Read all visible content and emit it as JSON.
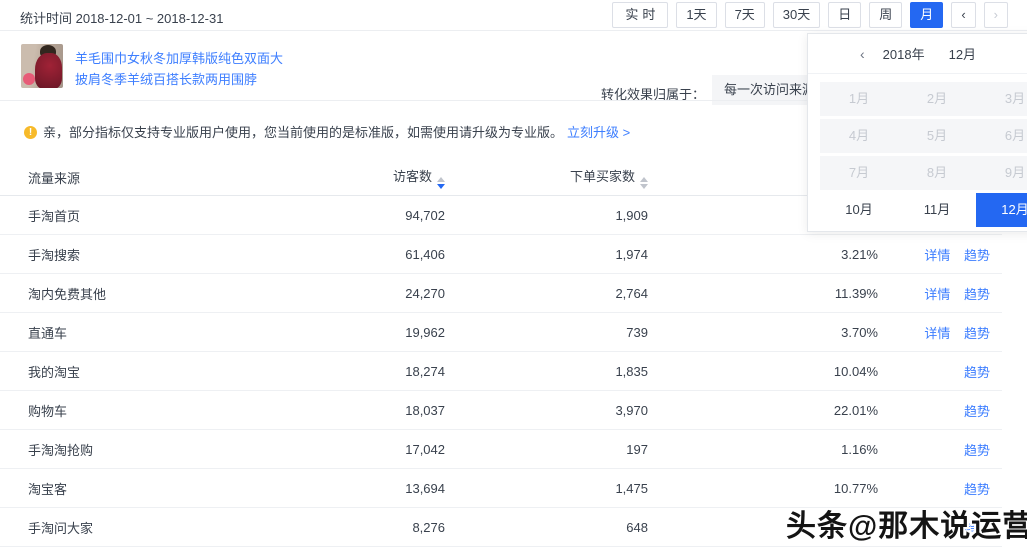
{
  "colors": {
    "accent": "#2468f2",
    "link": "#3d7eff",
    "warning": "#f7ba2a",
    "disabled_text": "#c6cad1"
  },
  "header": {
    "stat_time": "统计时间 2018-12-01 ~ 2018-12-31",
    "range_buttons": [
      {
        "label": "实时",
        "state": "normal"
      },
      {
        "label": "1天",
        "state": "normal"
      },
      {
        "label": "7天",
        "state": "normal"
      },
      {
        "label": "30天",
        "state": "normal"
      },
      {
        "label": "日",
        "state": "normal"
      },
      {
        "label": "周",
        "state": "normal"
      },
      {
        "label": "月",
        "state": "active"
      },
      {
        "label": "‹",
        "state": "normal"
      },
      {
        "label": "›",
        "state": "disabled"
      }
    ]
  },
  "product": {
    "title_line1": "羊毛围巾女秋冬加厚韩版纯色双面大",
    "title_line2": "披肩冬季羊绒百搭长款两用围脖",
    "attribution_label": "转化效果归属于：",
    "attribution_value": "每一次访问来源"
  },
  "notice": {
    "icon_char": "!",
    "text": "亲，部分指标仅支持专业版用户使用，您当前使用的是标准版，如需使用请升级为专业版。",
    "link": "立刻升级 >"
  },
  "date_picker": {
    "prev": "‹",
    "year": "2018年",
    "month": "12月",
    "months": [
      {
        "label": "1月",
        "state": "disabled"
      },
      {
        "label": "2月",
        "state": "disabled"
      },
      {
        "label": "3月",
        "state": "disabled"
      },
      {
        "label": "4月",
        "state": "disabled"
      },
      {
        "label": "5月",
        "state": "disabled"
      },
      {
        "label": "6月",
        "state": "disabled"
      },
      {
        "label": "7月",
        "state": "disabled"
      },
      {
        "label": "8月",
        "state": "disabled"
      },
      {
        "label": "9月",
        "state": "disabled"
      },
      {
        "label": "10月",
        "state": "normal"
      },
      {
        "label": "11月",
        "state": "normal"
      },
      {
        "label": "12月",
        "state": "active"
      }
    ]
  },
  "table": {
    "columns": [
      {
        "label": "流量来源",
        "sort": "none"
      },
      {
        "label": "访客数",
        "sort": "desc"
      },
      {
        "label": "下单买家数",
        "sort": "inactive"
      }
    ],
    "detail_label": "详情",
    "trend_label": "趋势",
    "rows": [
      {
        "name": "手淘首页",
        "visitors": "94,702",
        "buyers": "1,909",
        "pct": ""
      },
      {
        "name": "手淘搜索",
        "visitors": "61,406",
        "buyers": "1,974",
        "pct": "3.21%"
      },
      {
        "name": "淘内免费其他",
        "visitors": "24,270",
        "buyers": "2,764",
        "pct": "11.39%"
      },
      {
        "name": "直通车",
        "visitors": "19,962",
        "buyers": "739",
        "pct": "3.70%"
      },
      {
        "name": "我的淘宝",
        "visitors": "18,274",
        "buyers": "1,835",
        "pct": "10.04%"
      },
      {
        "name": "购物车",
        "visitors": "18,037",
        "buyers": "3,970",
        "pct": "22.01%"
      },
      {
        "name": "手淘淘抢购",
        "visitors": "17,042",
        "buyers": "197",
        "pct": "1.16%"
      },
      {
        "name": "淘宝客",
        "visitors": "13,694",
        "buyers": "1,475",
        "pct": "10.77%"
      },
      {
        "name": "手淘问大家",
        "visitors": "8,276",
        "buyers": "648",
        "pct": ""
      }
    ]
  },
  "watermark": "头条@那木说运营"
}
